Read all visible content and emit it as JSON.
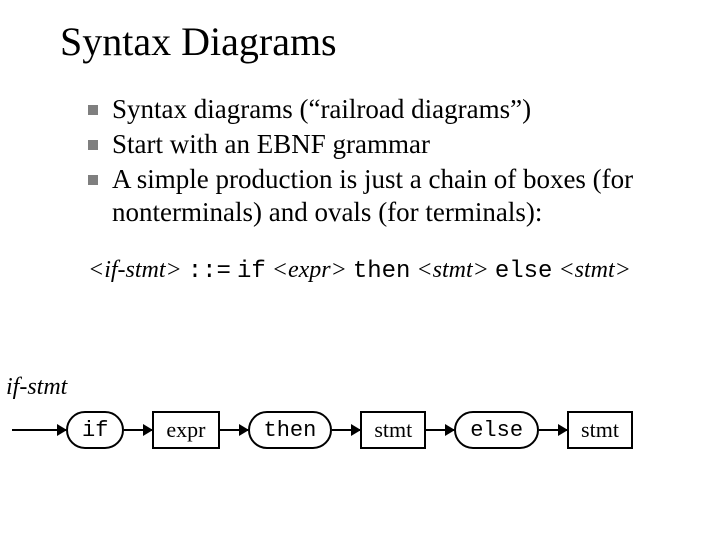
{
  "title": "Syntax Diagrams",
  "bullets": [
    "Syntax diagrams (“railroad diagrams”)",
    "Start with an EBNF grammar",
    "A simple production is just a chain of boxes (for nonterminals) and ovals (for terminals):"
  ],
  "ebnf": {
    "lhs": "<if-stmt>",
    "op": "::=",
    "parts": [
      {
        "t": "tt",
        "v": "if"
      },
      {
        "t": "nt",
        "v": "<expr>"
      },
      {
        "t": "tt",
        "v": "then"
      },
      {
        "t": "nt",
        "v": "<stmt>"
      },
      {
        "t": "tt",
        "v": "else"
      },
      {
        "t": "nt",
        "v": "<stmt>"
      }
    ]
  },
  "diagram": {
    "label": "if-stmt",
    "nodes": [
      {
        "kind": "term",
        "v": "if"
      },
      {
        "kind": "nonterm",
        "v": "expr"
      },
      {
        "kind": "term",
        "v": "then"
      },
      {
        "kind": "nonterm",
        "v": "stmt"
      },
      {
        "kind": "term",
        "v": "else"
      },
      {
        "kind": "nonterm",
        "v": "stmt"
      }
    ]
  }
}
